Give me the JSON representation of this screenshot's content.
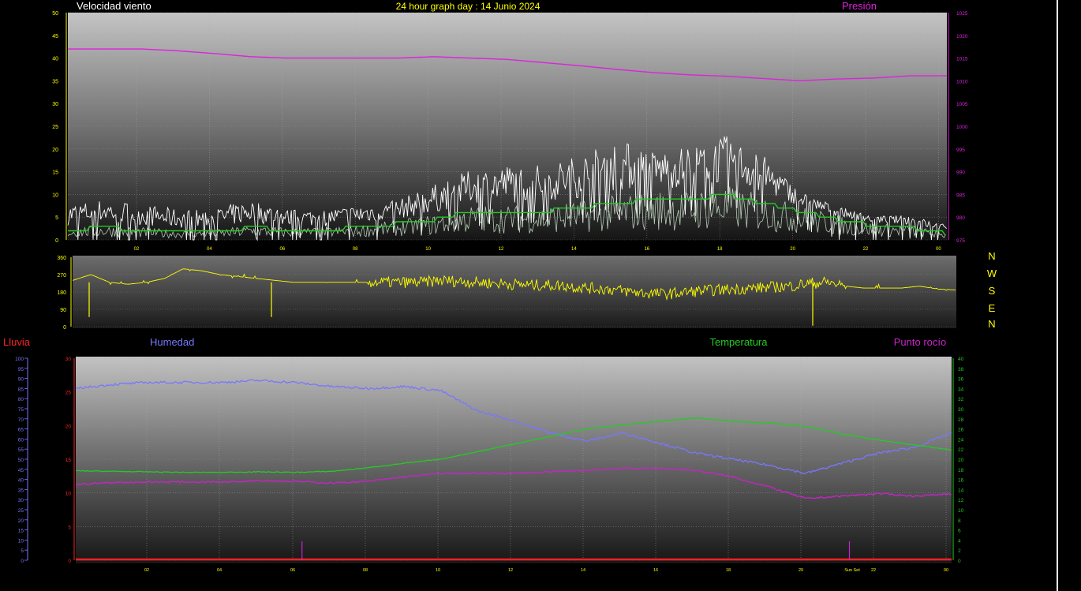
{
  "header": {
    "wind_label": "Velocidad viento",
    "title": "24 hour graph day : 14 Junio 2024",
    "pressure_label": "Presión"
  },
  "bottom_labels": {
    "rain": "Lluvia",
    "humidity": "Humedad",
    "temperature": "Temperatura",
    "dewpoint": "Punto rocío"
  },
  "colors": {
    "wind": "#ffffff",
    "wind_avg": "#22cc22",
    "gust": "#ffffff",
    "pressure": "#dd22dd",
    "direction": "#ffff00",
    "humidity": "#7777ff",
    "temperature": "#22cc22",
    "dewpoint": "#cc22cc",
    "rain": "#ff2222",
    "header_text": "#ffff00"
  },
  "compass": [
    "N",
    "W",
    "S",
    "E",
    "N"
  ],
  "chart_data": [
    {
      "name": "wind",
      "type": "line",
      "x_ticks": [
        "02",
        "04",
        "06",
        "08",
        "10",
        "12",
        "14",
        "16",
        "18",
        "20",
        "22",
        "00"
      ],
      "left_axis": {
        "ylim": [
          0,
          50
        ],
        "ticks": [
          "0",
          "5",
          "10",
          "15",
          "20",
          "25",
          "30",
          "35",
          "40",
          "45",
          "50"
        ]
      },
      "right_axis": {
        "ylim": [
          975,
          1025
        ],
        "ticks": [
          "975",
          "980",
          "985",
          "990",
          "995",
          "1000",
          "1005",
          "1010",
          "1015",
          "1020",
          "1025"
        ]
      },
      "series": [
        {
          "key": "pressure",
          "axis": "right",
          "x": [
            0,
            1,
            2,
            3,
            4,
            5,
            6,
            7,
            8,
            9,
            10,
            11,
            12,
            13,
            14,
            15,
            16,
            17,
            18,
            19,
            20,
            21,
            22,
            23,
            24
          ],
          "y": [
            1017,
            1017,
            1017,
            1016.6,
            1016,
            1015.3,
            1015,
            1015,
            1015,
            1015,
            1015.3,
            1015,
            1014.7,
            1014,
            1013.3,
            1012.5,
            1011.8,
            1011.3,
            1011,
            1010.5,
            1010,
            1010.4,
            1010.6,
            1011.1,
            1011.1
          ]
        },
        {
          "key": "wind_avg",
          "axis": "left",
          "x": [
            0,
            1,
            2,
            3,
            4,
            5,
            6,
            7,
            8,
            9,
            10,
            11,
            12,
            13,
            14,
            15,
            16,
            17,
            18,
            19,
            20,
            21,
            22,
            23,
            24
          ],
          "y": [
            2.5,
            3,
            2.5,
            2,
            2,
            3,
            2.5,
            2.5,
            3,
            4,
            5,
            7,
            7,
            7,
            8,
            9,
            10,
            10,
            11,
            9,
            7,
            5,
            3.5,
            3,
            1.5
          ]
        },
        {
          "key": "gust",
          "axis": "left",
          "x": [
            0,
            1,
            2,
            3,
            4,
            5,
            6,
            7,
            8,
            9,
            10,
            11,
            12,
            13,
            14,
            15,
            16,
            17,
            18,
            19,
            20,
            21,
            22,
            23,
            24
          ],
          "y": [
            7,
            8,
            7,
            6,
            6,
            8,
            6,
            6,
            7,
            8,
            11,
            14,
            15,
            15,
            17,
            20,
            18,
            19,
            21,
            17,
            10,
            7,
            5,
            5,
            3
          ]
        }
      ]
    },
    {
      "name": "direction",
      "type": "line",
      "ylim": [
        0,
        360
      ],
      "ticks": [
        "0",
        "90",
        "180",
        "270",
        "360"
      ],
      "x": [
        0,
        0.5,
        1,
        1.5,
        2,
        2.5,
        3,
        3.5,
        4,
        4.5,
        5,
        5.5,
        6,
        6.5,
        7,
        7.5,
        8,
        8.5,
        9,
        9.5,
        10,
        10.5,
        11,
        11.5,
        12,
        12.5,
        13,
        13.5,
        14,
        14.5,
        15,
        15.5,
        16,
        16.5,
        17,
        17.5,
        18,
        18.5,
        19,
        19.5,
        20,
        20.5,
        21,
        21.5,
        22,
        22.5,
        23,
        23.5,
        24
      ],
      "y": [
        240,
        270,
        230,
        220,
        230,
        250,
        300,
        290,
        270,
        260,
        250,
        240,
        230,
        230,
        230,
        230,
        230,
        230,
        230,
        230,
        240,
        235,
        230,
        225,
        220,
        215,
        215,
        210,
        200,
        195,
        185,
        175,
        170,
        175,
        185,
        190,
        195,
        200,
        205,
        210,
        225,
        230,
        210,
        200,
        200,
        200,
        210,
        195,
        190
      ]
    },
    {
      "name": "environment",
      "type": "line",
      "x_ticks": [
        "02",
        "04",
        "06",
        "08",
        "10",
        "12",
        "14",
        "16",
        "18",
        "20",
        "Sun Set",
        "22",
        "00"
      ],
      "humidity_axis": {
        "ylim": [
          0,
          100
        ],
        "ticks": [
          "0",
          "5",
          "10",
          "15",
          "20",
          "25",
          "30",
          "35",
          "40",
          "45",
          "50",
          "55",
          "60",
          "65",
          "70",
          "75",
          "80",
          "85",
          "90",
          "95",
          "100"
        ]
      },
      "mid_axis": {
        "ylim": [
          0,
          30
        ],
        "ticks": [
          "0",
          "5",
          "10",
          "15",
          "20",
          "25",
          "30"
        ]
      },
      "temp_axis": {
        "ylim": [
          0,
          40
        ],
        "ticks": [
          "0",
          "2",
          "4",
          "6",
          "8",
          "10",
          "12",
          "14",
          "16",
          "18",
          "20",
          "22",
          "24",
          "26",
          "28",
          "30",
          "32",
          "34",
          "36",
          "38",
          "40"
        ]
      },
      "series": [
        {
          "key": "humidity",
          "axis": "humidity",
          "x": [
            0,
            1,
            2,
            3,
            4,
            5,
            6,
            7,
            8,
            9,
            10,
            11,
            12,
            13,
            14,
            15,
            16,
            17,
            18,
            19,
            20,
            21,
            22,
            23,
            24
          ],
          "y": [
            85,
            87,
            88,
            88,
            88,
            89,
            88,
            86,
            85,
            86,
            84,
            74,
            69,
            63,
            59,
            63,
            58,
            53,
            50,
            47,
            43,
            48,
            53,
            56,
            63
          ]
        },
        {
          "key": "temperature",
          "axis": "temp",
          "x": [
            0,
            1,
            2,
            3,
            4,
            5,
            6,
            7,
            8,
            9,
            10,
            11,
            12,
            13,
            14,
            15,
            16,
            17,
            18,
            19,
            20,
            21,
            22,
            23,
            24
          ],
          "y": [
            17.7,
            17.6,
            17.5,
            17.4,
            17.4,
            17.5,
            17.4,
            17.6,
            18.3,
            19.2,
            20,
            21.5,
            23,
            24.5,
            26,
            26.8,
            27.5,
            28.2,
            27.5,
            27.2,
            26.5,
            25,
            23.8,
            22.8,
            21.8
          ]
        },
        {
          "key": "dewpoint",
          "axis": "temp",
          "x": [
            0,
            1,
            2,
            3,
            4,
            5,
            6,
            7,
            8,
            9,
            10,
            11,
            12,
            13,
            14,
            15,
            16,
            17,
            18,
            19,
            20,
            21,
            22,
            23,
            24
          ],
          "y": [
            15,
            15.4,
            15.5,
            15.5,
            15.5,
            15.8,
            15.6,
            15.3,
            15.6,
            16.5,
            17.2,
            17.2,
            17.2,
            17.5,
            17.8,
            18.2,
            18.2,
            17.8,
            16.5,
            14.5,
            12.2,
            12.7,
            13.2,
            12.7,
            13.2
          ]
        },
        {
          "key": "rain",
          "axis": "mid",
          "x": [
            0,
            24
          ],
          "y": [
            0,
            0
          ]
        }
      ],
      "markers_hours": [
        6.2,
        21.2
      ]
    }
  ]
}
